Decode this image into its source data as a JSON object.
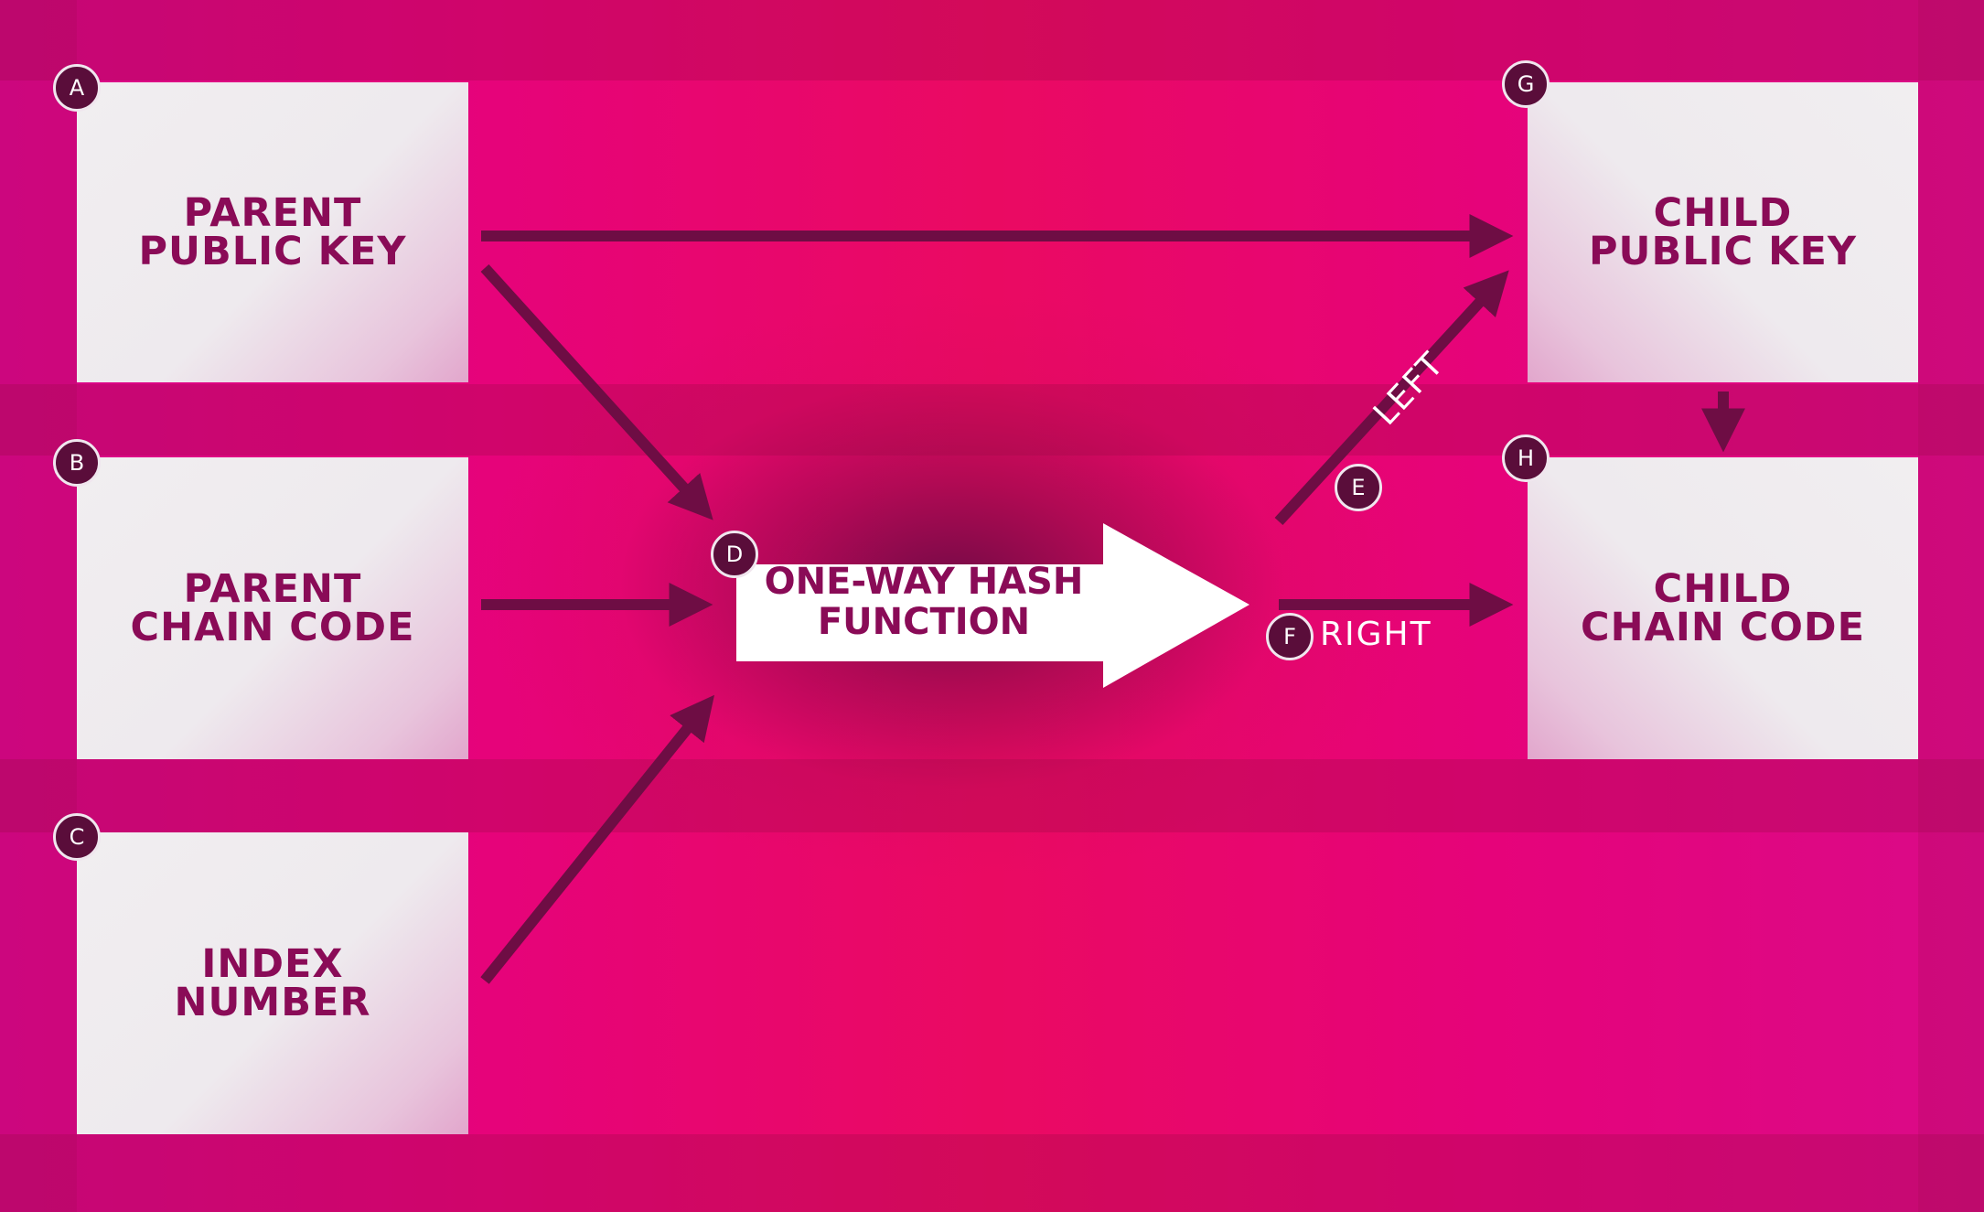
{
  "boxes": {
    "parent_public_key": {
      "badge": "A",
      "label": "PARENT\nPUBLIC KEY"
    },
    "parent_chain_code": {
      "badge": "B",
      "label": "PARENT\nCHAIN CODE"
    },
    "index_number": {
      "badge": "C",
      "label": "INDEX\nNUMBER"
    },
    "child_public_key": {
      "badge": "G",
      "label": "CHILD\nPUBLIC KEY"
    },
    "child_chain_code": {
      "badge": "H",
      "label": "CHILD\nCHAIN CODE"
    }
  },
  "hash": {
    "badge": "D",
    "label": "ONE-WAY HASH\nFUNCTION"
  },
  "outputs": {
    "left": {
      "badge": "E",
      "label": "LEFT"
    },
    "right": {
      "badge": "F",
      "label": "RIGHT"
    }
  },
  "colors": {
    "background": "#e8046c",
    "box_fill": "#eeeaee",
    "box_text": "#8a0b57",
    "arrow": "#6e0d44",
    "badge": "#5a0d3a"
  }
}
